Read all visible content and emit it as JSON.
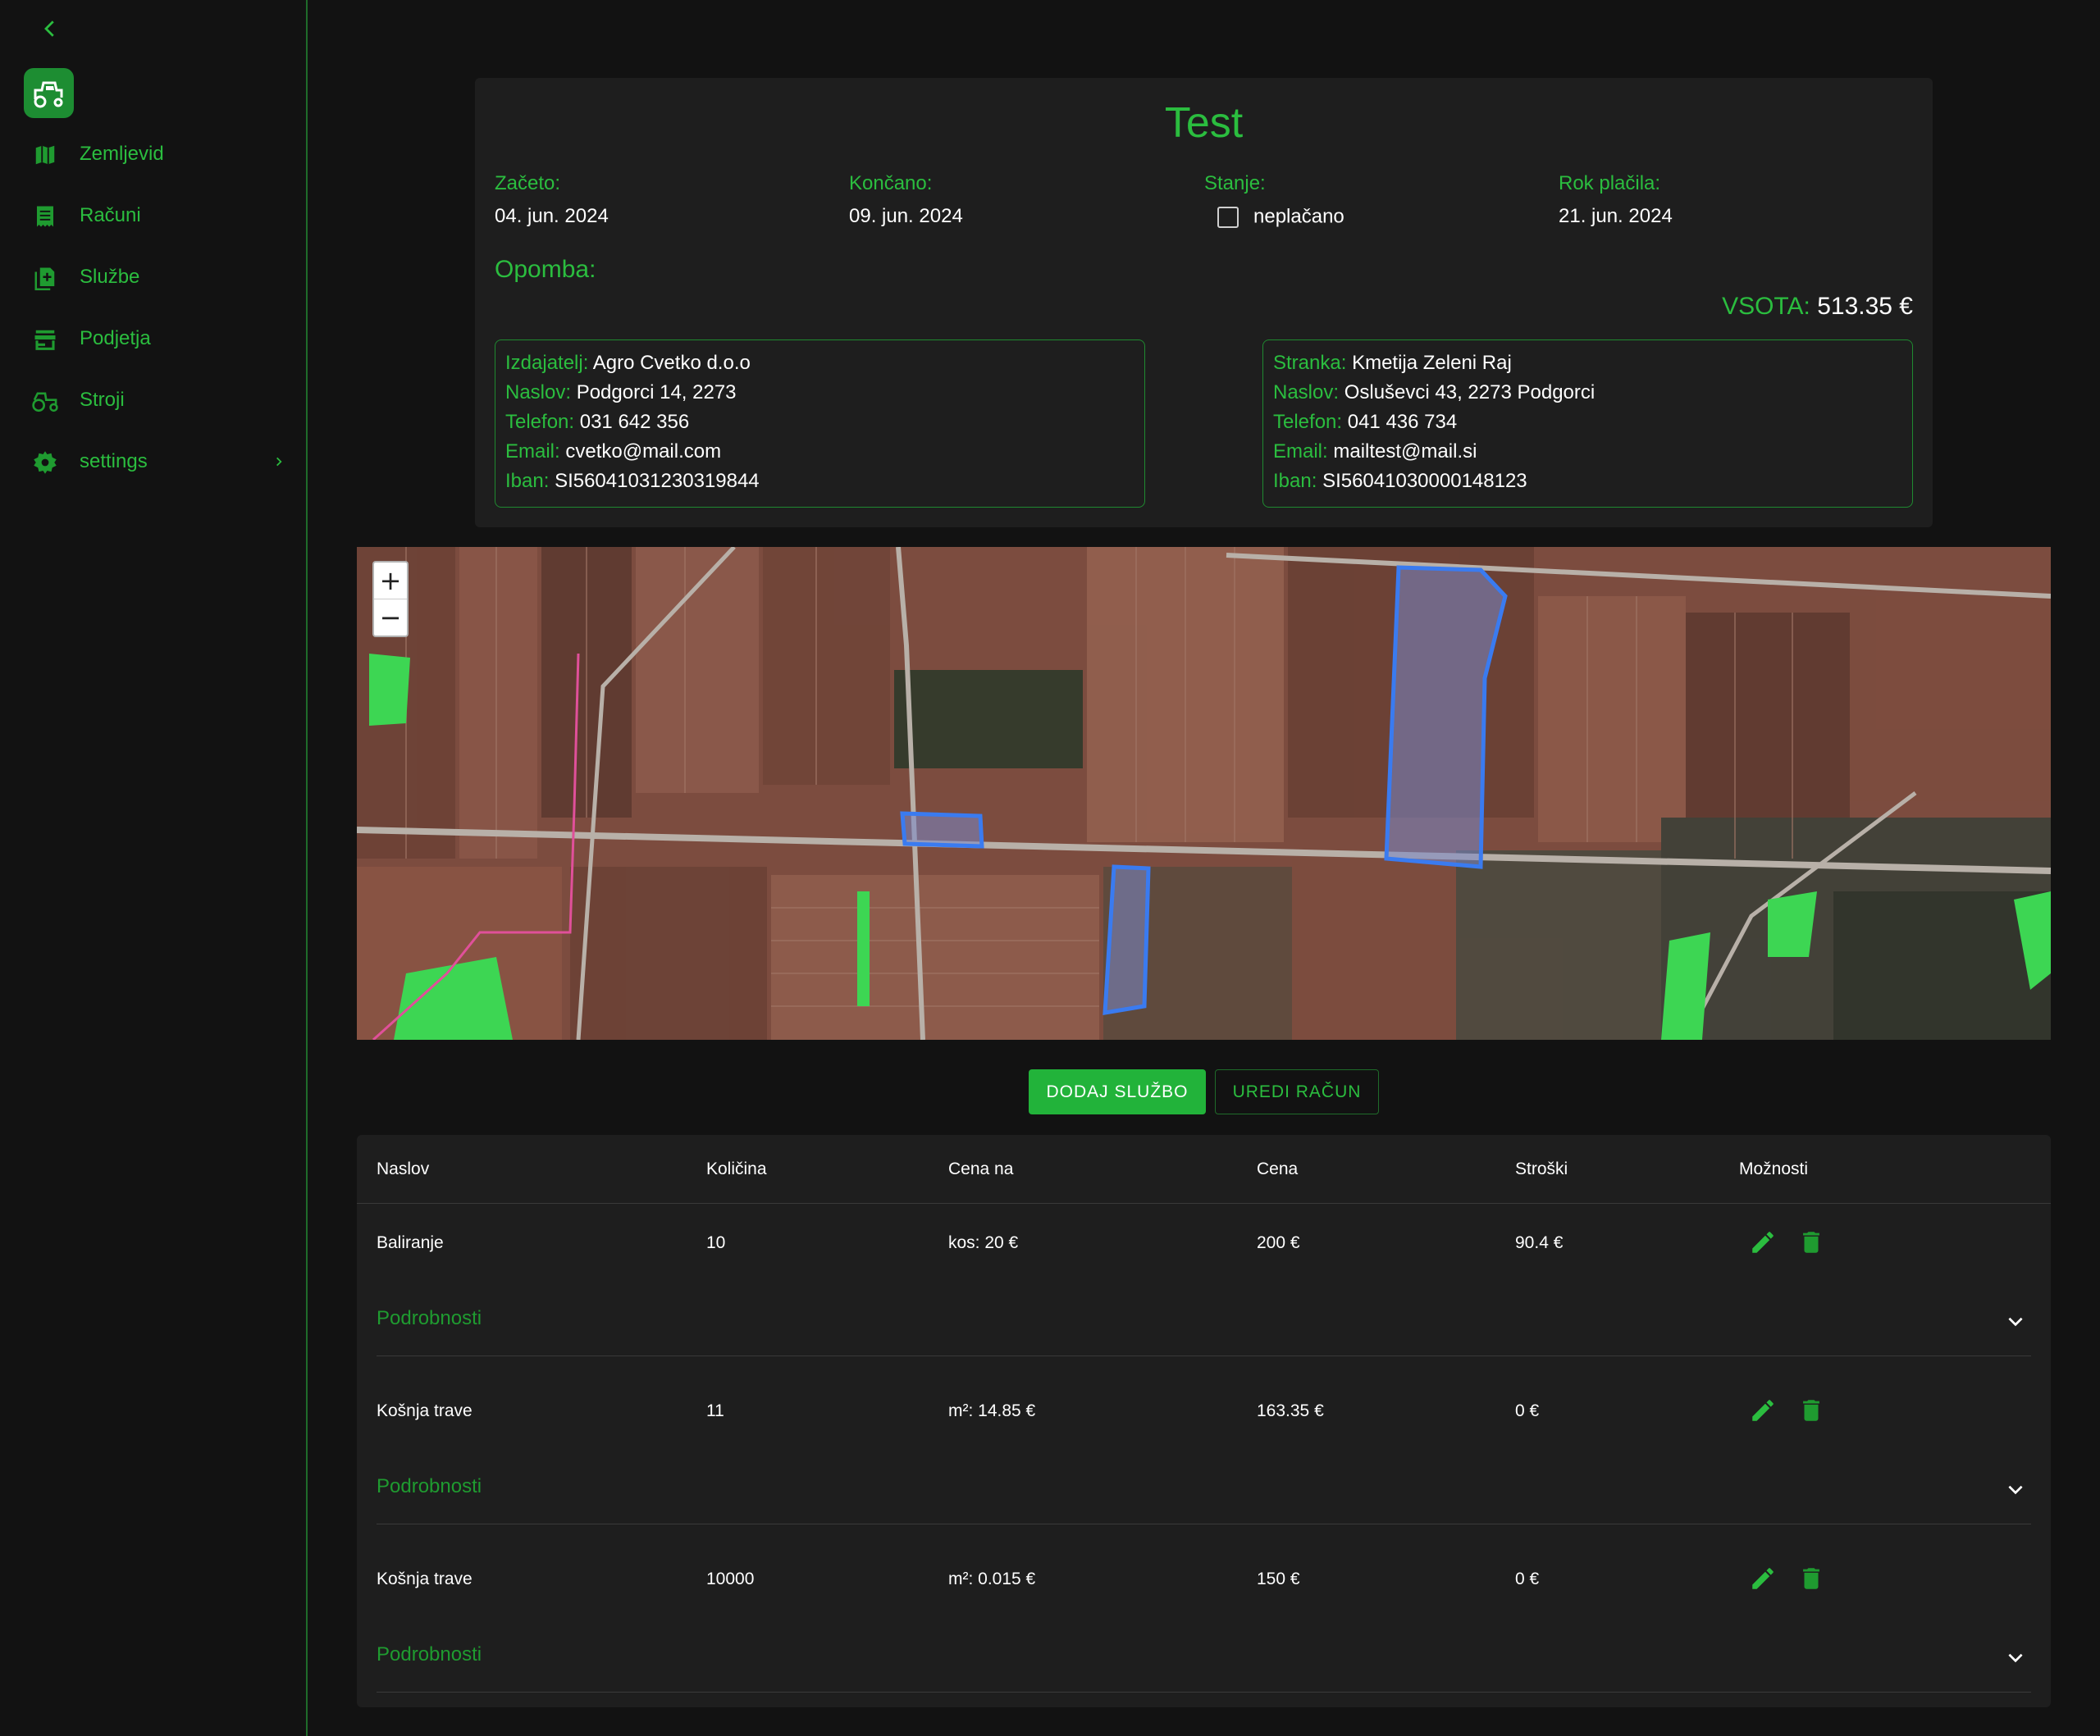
{
  "sidebar": {
    "items": [
      {
        "label": "Zemljevid",
        "icon": "map-icon"
      },
      {
        "label": "Računi",
        "icon": "receipt-icon"
      },
      {
        "label": "Službe",
        "icon": "add-document-icon"
      },
      {
        "label": "Podjetja",
        "icon": "store-icon"
      },
      {
        "label": "Stroji",
        "icon": "tractor-icon"
      },
      {
        "label": "settings",
        "icon": "gear-icon"
      }
    ]
  },
  "invoice": {
    "title": "Test",
    "started_label": "Začeto:",
    "started_value": "04. jun. 2024",
    "finished_label": "Končano:",
    "finished_value": "09. jun. 2024",
    "status_label": "Stanje:",
    "status_value": "neplačano",
    "due_label": "Rok plačila:",
    "due_value": "21. jun. 2024",
    "note_label": "Opomba:",
    "total_label": "VSOTA:",
    "total_value": "513.35 €"
  },
  "issuer": {
    "name_label": "Izdajatelj:",
    "name": "Agro Cvetko d.o.o",
    "address_label": "Naslov:",
    "address": "Podgorci 14, 2273",
    "phone_label": "Telefon:",
    "phone": "031 642 356",
    "email_label": "Email:",
    "email": "cvetko@mail.com",
    "iban_label": "Iban:",
    "iban": "SI56041031230319844"
  },
  "client": {
    "name_label": "Stranka:",
    "name": "Kmetija Zeleni Raj",
    "address_label": "Naslov:",
    "address": "Osluševci 43, 2273 Podgorci",
    "phone_label": "Telefon:",
    "phone": "041 436 734",
    "email_label": "Email:",
    "email": "mailtest@mail.si",
    "iban_label": "Iban:",
    "iban": "SI56041030000148123"
  },
  "map": {
    "zoom_in": "+",
    "zoom_out": "−"
  },
  "actions": {
    "add_service": "DODAJ SLUŽBO",
    "edit_invoice": "UREDI RAČUN"
  },
  "table": {
    "headers": [
      "Naslov",
      "Količina",
      "Cena na",
      "Cena",
      "Stroški",
      "Možnosti"
    ],
    "details_label": "Podrobnosti",
    "rows": [
      {
        "title": "Baliranje",
        "quantity": "10",
        "unit_price": "kos: 20 €",
        "price": "200 €",
        "costs": "90.4 €"
      },
      {
        "title": "Košnja trave",
        "quantity": "11",
        "unit_price": "m²: 14.85 €",
        "price": "163.35 €",
        "costs": "0 €"
      },
      {
        "title": "Košnja trave",
        "quantity": "10000",
        "unit_price": "m²: 0.015 €",
        "price": "150 €",
        "costs": "0 €"
      }
    ]
  },
  "colors": {
    "accent": "#2bbd3f",
    "button": "#22b33a",
    "background": "#121212",
    "card": "#1e1e1e"
  }
}
